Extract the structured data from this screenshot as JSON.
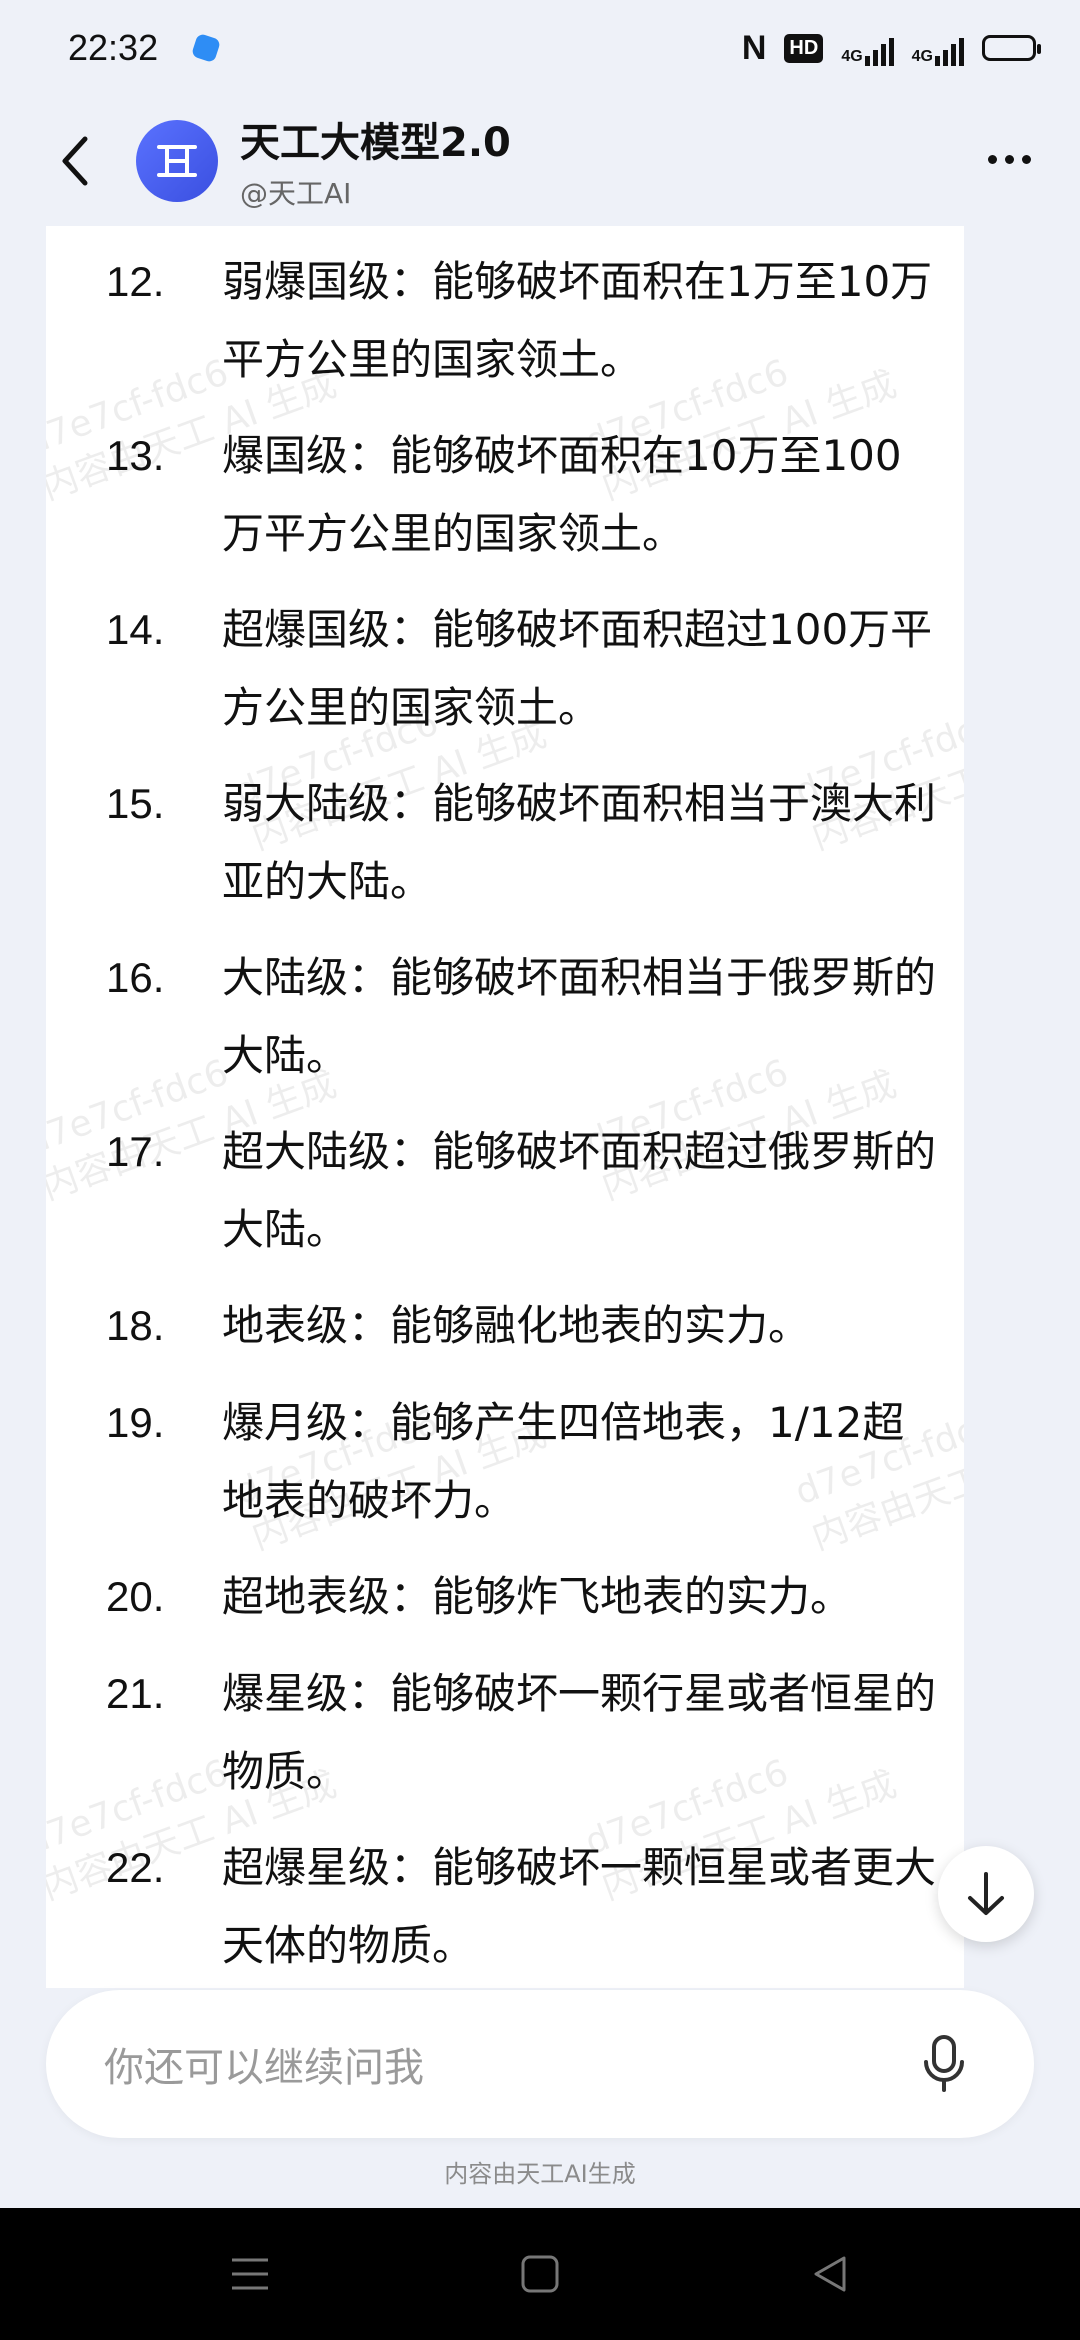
{
  "status_bar": {
    "time": "22:32",
    "nfc_label": "N",
    "hd_label": "HD",
    "signal1": "4G",
    "signal2": "4G"
  },
  "header": {
    "title": "天工大模型2.0",
    "subtitle": "@天工AI"
  },
  "items": [
    {
      "num": "12.",
      "text": "弱爆国级：能够破坏面积在1万至10万平方公里的国家领土。"
    },
    {
      "num": "13.",
      "text": "爆国级：能够破坏面积在10万至100万平方公里的国家领土。"
    },
    {
      "num": "14.",
      "text": "超爆国级：能够破坏面积超过100万平方公里的国家领土。"
    },
    {
      "num": "15.",
      "text": "弱大陆级：能够破坏面积相当于澳大利亚的大陆。"
    },
    {
      "num": "16.",
      "text": "大陆级：能够破坏面积相当于俄罗斯的大陆。"
    },
    {
      "num": "17.",
      "text": "超大陆级：能够破坏面积超过俄罗斯的大陆。"
    },
    {
      "num": "18.",
      "text": "地表级：能够融化地表的实力。"
    },
    {
      "num": "19.",
      "text": "爆月级：能够产生四倍地表，1/12超地表的破坏力。"
    },
    {
      "num": "20.",
      "text": "超地表级：能够炸飞地表的实力。"
    },
    {
      "num": "21.",
      "text": "爆星级：能够破坏一颗行星或者恒星的物质。"
    },
    {
      "num": "22.",
      "text": "超爆星级：能够破坏一颗恒星或者更大天体的物质。"
    }
  ],
  "watermark": {
    "line1": "d7e7cf-fdc6",
    "line2": "内容由天工 AI 生成"
  },
  "input": {
    "placeholder": "你还可以继续问我"
  },
  "footer_note": "内容由天工AI生成",
  "colors": {
    "accent": "#4a5ff0",
    "background": "#eef1f8",
    "card": "#ffffff",
    "nav": "#000000"
  }
}
